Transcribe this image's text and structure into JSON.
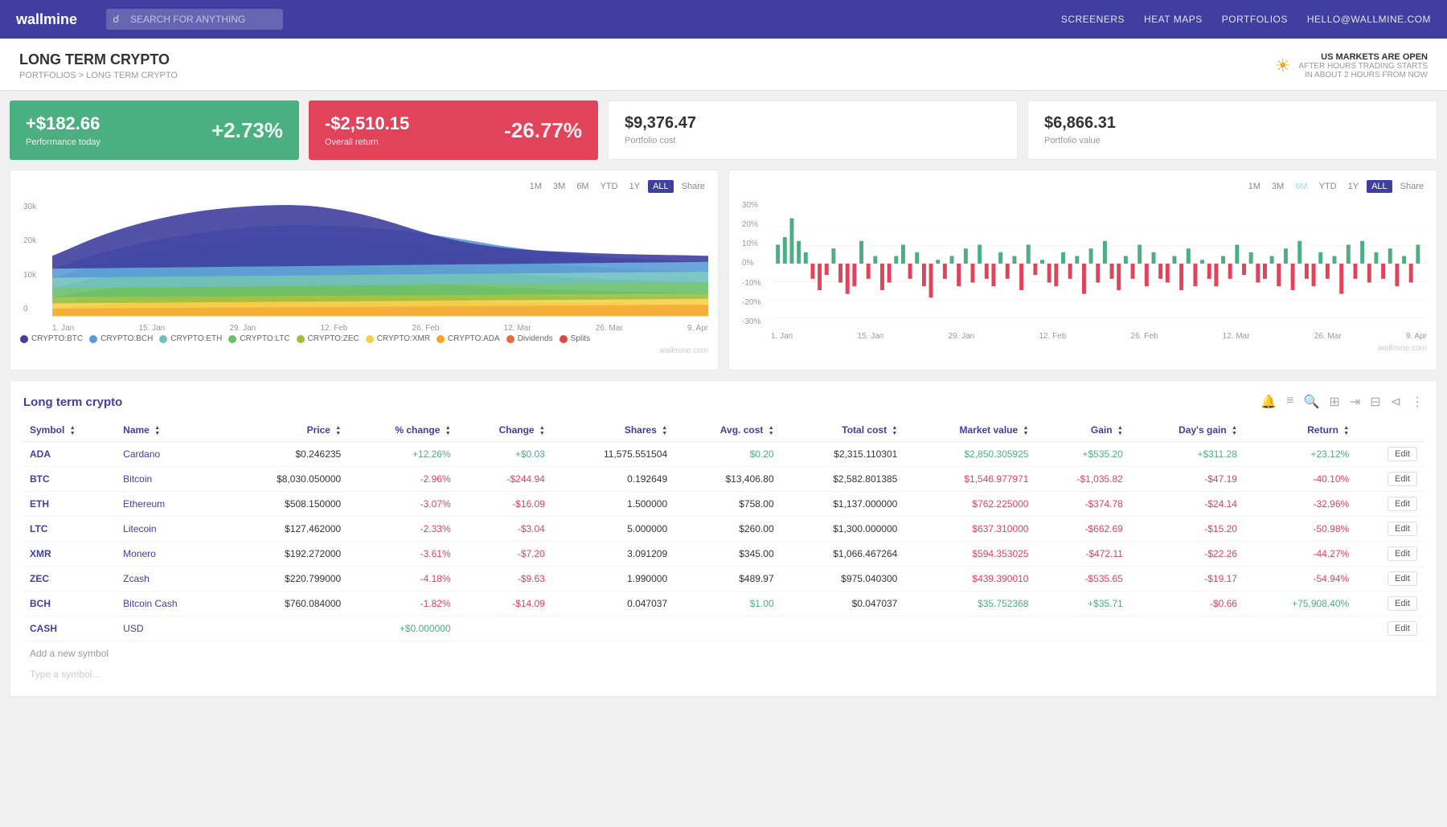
{
  "header": {
    "logo": "wallmine",
    "search_placeholder": "SEARCH FOR ANYTHING",
    "nav": [
      "SCREENERS",
      "HEAT MAPS",
      "PORTFOLIOS",
      "HELLO@WALLMINE.COM"
    ]
  },
  "page": {
    "title": "LONG TERM CRYPTO",
    "breadcrumb": "PORTFOLIOS > LONG TERM CRYPTO"
  },
  "market_status": {
    "line1": "US MARKETS ARE OPEN",
    "line2": "AFTER HOURS TRADING STARTS",
    "line3": "IN ABOUT 2 HOURS FROM NOW"
  },
  "cards": {
    "performance": {
      "value": "+$182.66",
      "label": "Performance today",
      "pct": "+2.73%"
    },
    "overall": {
      "value": "-$2,510.15",
      "label": "Overall return",
      "pct": "-26.77%"
    },
    "cost": {
      "value": "$9,376.47",
      "label": "Portfolio cost"
    },
    "portfolio_value": {
      "value": "$6,866.31",
      "label": "Portfolio value"
    }
  },
  "chart_controls": [
    "1M",
    "3M",
    "6M",
    "YTD",
    "1Y",
    "ALL",
    "Share"
  ],
  "legend": [
    {
      "label": "CRYPTO:BTC",
      "color": "#3f3f9f"
    },
    {
      "label": "CRYPTO:BCH",
      "color": "#5b9bd5"
    },
    {
      "label": "CRYPTO:ETH",
      "color": "#70c0c0"
    },
    {
      "label": "CRYPTO:LTC",
      "color": "#6abf6a"
    },
    {
      "label": "CRYPTO:ZEC",
      "color": "#9abf3f"
    },
    {
      "label": "CRYPTO:XMR",
      "color": "#f5d04a"
    },
    {
      "label": "CRYPTO:ADA",
      "color": "#f5a623"
    },
    {
      "label": "Dividends",
      "color": "#e86c3a"
    },
    {
      "label": "Splits",
      "color": "#e04545"
    }
  ],
  "watermark": "wallmine.com",
  "portfolio_table": {
    "title": "Long term crypto",
    "columns": [
      "Symbol",
      "Name",
      "Price",
      "% change",
      "Change",
      "Shares",
      "Avg. cost",
      "Total cost",
      "Market value",
      "Gain",
      "Day's gain",
      "Return"
    ],
    "rows": [
      {
        "sym": "ADA",
        "name": "Cardano",
        "price": "$0.246235",
        "pct_change": "+12.26%",
        "change": "+$0.03",
        "shares": "11,575.551504",
        "avg_cost": "$0.20",
        "total_cost": "$2,315.110301",
        "market_value": "$2,850.305925",
        "gain": "+$535.20",
        "days_gain": "+$311.28",
        "return": "+23.12%",
        "pos": true
      },
      {
        "sym": "BTC",
        "name": "Bitcoin",
        "price": "$8,030.050000",
        "pct_change": "-2.96%",
        "change": "-$244.94",
        "shares": "0.192649",
        "avg_cost": "$13,406.80",
        "total_cost": "$2,582.801385",
        "market_value": "$1,546.977971",
        "gain": "-$1,035.82",
        "days_gain": "-$47.19",
        "return": "-40.10%",
        "pos": false
      },
      {
        "sym": "ETH",
        "name": "Ethereum",
        "price": "$508.150000",
        "pct_change": "-3.07%",
        "change": "-$16.09",
        "shares": "1.500000",
        "avg_cost": "$758.00",
        "total_cost": "$1,137.000000",
        "market_value": "$762.225000",
        "gain": "-$374.78",
        "days_gain": "-$24.14",
        "return": "-32.96%",
        "pos": false
      },
      {
        "sym": "LTC",
        "name": "Litecoin",
        "price": "$127.462000",
        "pct_change": "-2.33%",
        "change": "-$3.04",
        "shares": "5.000000",
        "avg_cost": "$260.00",
        "total_cost": "$1,300.000000",
        "market_value": "$637.310000",
        "gain": "-$662.69",
        "days_gain": "-$15.20",
        "return": "-50.98%",
        "pos": false
      },
      {
        "sym": "XMR",
        "name": "Monero",
        "price": "$192.272000",
        "pct_change": "-3.61%",
        "change": "-$7.20",
        "shares": "3.091209",
        "avg_cost": "$345.00",
        "total_cost": "$1,066.467264",
        "market_value": "$594.353025",
        "gain": "-$472.11",
        "days_gain": "-$22.26",
        "return": "-44.27%",
        "pos": false
      },
      {
        "sym": "ZEC",
        "name": "Zcash",
        "price": "$220.799000",
        "pct_change": "-4.18%",
        "change": "-$9.63",
        "shares": "1.990000",
        "avg_cost": "$489.97",
        "total_cost": "$975.040300",
        "market_value": "$439.390010",
        "gain": "-$535.65",
        "days_gain": "-$19.17",
        "return": "-54.94%",
        "pos": false
      },
      {
        "sym": "BCH",
        "name": "Bitcoin Cash",
        "price": "$760.084000",
        "pct_change": "-1.82%",
        "change": "-$14.09",
        "shares": "0.047037",
        "avg_cost": "$1.00",
        "total_cost": "$0.047037",
        "market_value": "$35.752368",
        "gain": "+$35.71",
        "days_gain": "-$0.66",
        "return": "+75,908.40%",
        "pos": true
      },
      {
        "sym": "CASH",
        "name": "USD",
        "price": "",
        "pct_change": "+$0.000000",
        "change": "",
        "shares": "",
        "avg_cost": "",
        "total_cost": "",
        "market_value": "",
        "gain": "",
        "days_gain": "",
        "return": "",
        "pos": true
      }
    ],
    "add_symbol": "Add a new symbol",
    "type_symbol": "Type a symbol..."
  }
}
